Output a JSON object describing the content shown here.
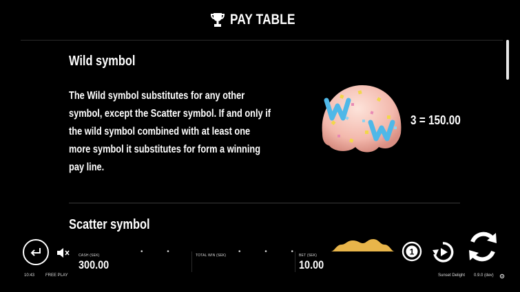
{
  "header": {
    "title": "PAY TABLE",
    "icon": "trophy-icon"
  },
  "wild": {
    "title": "Wild symbol",
    "description_lines": [
      "The Wild symbol substitutes for any other",
      "symbol, except the Scatter symbol. If and only if",
      "the wild symbol combined with at least one",
      "more symbol it substitutes for form a winning",
      "pay line."
    ],
    "payout": "3 = 150.00"
  },
  "scatter": {
    "title": "Scatter symbol"
  },
  "bottom_bar": {
    "cash_label": "CASH (SEK)",
    "cash_value": "300.00",
    "total_win_label": "TOTAL WIN (SEK)",
    "bet_label": "BET (SEK)",
    "bet_value": "10.00"
  },
  "footer": {
    "time": "10:43",
    "mode": "FREE PLAY",
    "game_name": "Sunset Delight",
    "version": "0.9.0 (dev)"
  },
  "colors": {
    "background": "#000000",
    "text": "#ffffff",
    "wave": "#e8b54a",
    "symbol_base": "#f5c8c0",
    "symbol_w": "#4fb8e8"
  }
}
